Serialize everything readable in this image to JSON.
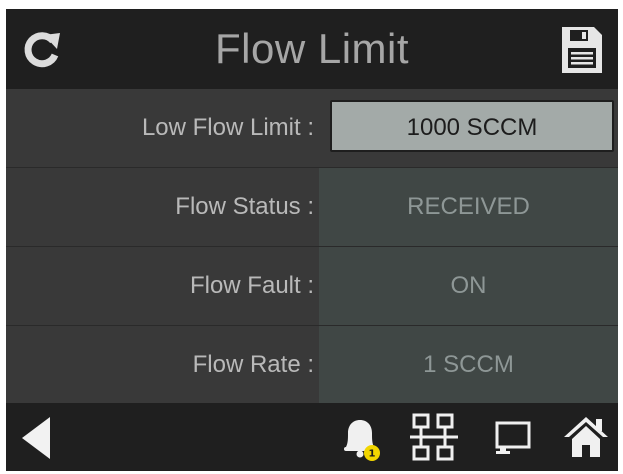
{
  "header": {
    "title": "Flow Limit",
    "refresh_icon": "refresh-icon",
    "save_icon": "save-icon"
  },
  "rows": [
    {
      "label": "Low Flow Limit :",
      "value": "1000 SCCM",
      "editable": true
    },
    {
      "label": "Flow Status :",
      "value": "RECEIVED",
      "editable": false
    },
    {
      "label": "Flow Fault :",
      "value": "ON",
      "editable": false
    },
    {
      "label": "Flow Rate :",
      "value": "1 SCCM",
      "editable": false
    }
  ],
  "footer": {
    "back_icon": "back-arrow-icon",
    "alarm_icon": "alarm-bell-icon",
    "alarm_count": "1",
    "network_icon": "network-icon",
    "device_icon": "device-icon",
    "home_icon": "home-icon"
  },
  "colors": {
    "header_bg": "#1f1f1f",
    "row_bg": "#393939",
    "value_bg": "#404745",
    "input_bg": "#a3aaa8",
    "title_text": "#a6a6a6",
    "label_text": "#b9b9b9",
    "value_text": "#8e9796",
    "alarm_badge": "#f2d600"
  }
}
